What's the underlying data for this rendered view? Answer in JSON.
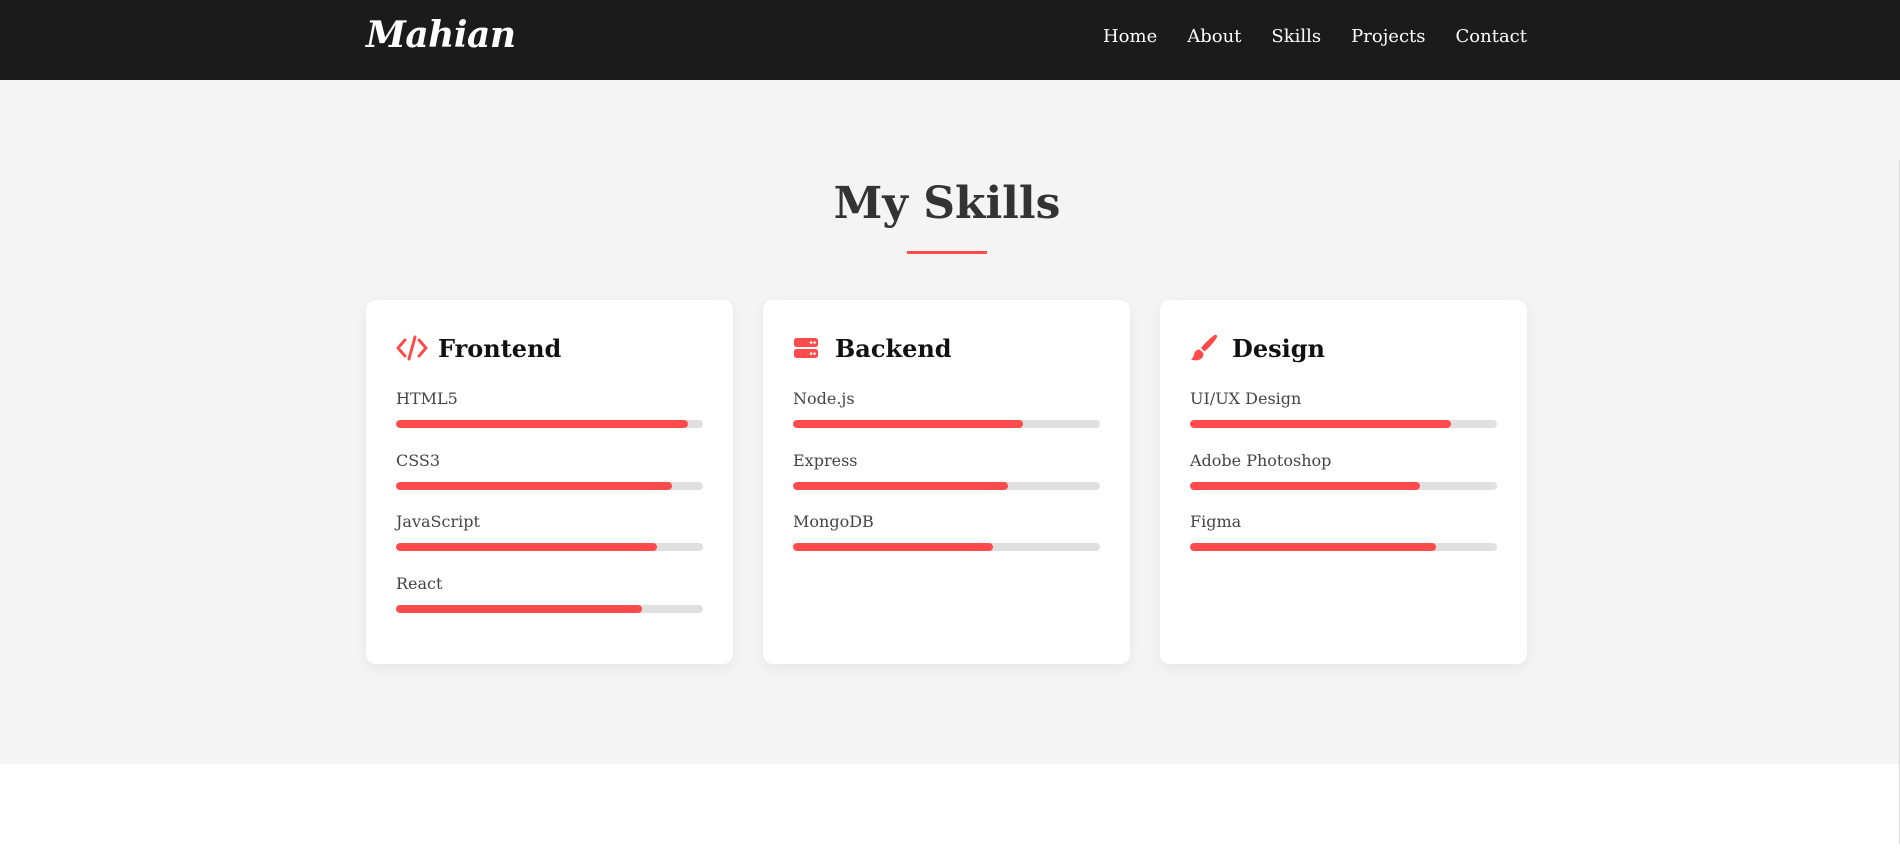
{
  "nav": {
    "brand": "Mahian",
    "links": [
      "Home",
      "About",
      "Skills",
      "Projects",
      "Contact"
    ]
  },
  "section": {
    "title": "My Skills"
  },
  "colors": {
    "accent": "#ff4b4b",
    "navbar_bg": "#1b1b1b",
    "section_bg": "#f4f4f4",
    "bar_track": "#e0e0e0"
  },
  "cards": [
    {
      "title": "Frontend",
      "icon": "code-icon",
      "skills": [
        {
          "name": "HTML5",
          "percent": 95
        },
        {
          "name": "CSS3",
          "percent": 90
        },
        {
          "name": "JavaScript",
          "percent": 85
        },
        {
          "name": "React",
          "percent": 80
        }
      ]
    },
    {
      "title": "Backend",
      "icon": "server-icon",
      "skills": [
        {
          "name": "Node.js",
          "percent": 75
        },
        {
          "name": "Express",
          "percent": 70
        },
        {
          "name": "MongoDB",
          "percent": 65
        }
      ]
    },
    {
      "title": "Design",
      "icon": "paintbrush-icon",
      "skills": [
        {
          "name": "UI/UX Design",
          "percent": 85
        },
        {
          "name": "Adobe Photoshop",
          "percent": 75
        },
        {
          "name": "Figma",
          "percent": 80
        }
      ]
    }
  ]
}
